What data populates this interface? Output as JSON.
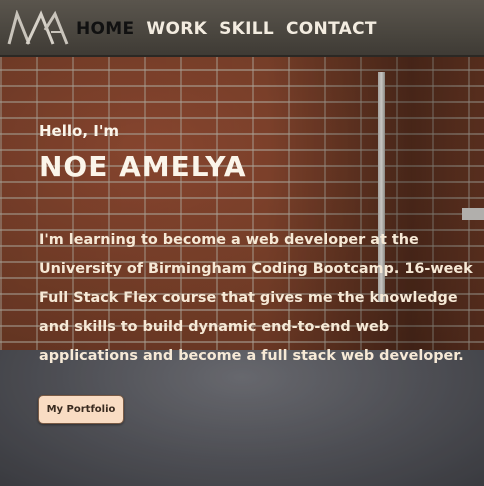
{
  "header": {
    "logo_text": "NA",
    "nav": [
      {
        "label": "HOME",
        "active": true
      },
      {
        "label": "WORK",
        "active": false
      },
      {
        "label": "SKILL",
        "active": false
      },
      {
        "label": "CONTACT",
        "active": false
      }
    ]
  },
  "hero": {
    "greeting": "Hello, I'm",
    "name": "NOE AMELYA",
    "bio": "I'm learning to become a web developer at the University of Birmingham Coding Bootcamp. 16-week Full Stack Flex course that gives me the knowledge and skills to build dynamic end-to-end web applications and become a full stack web developer.",
    "cta_label": "My Portfolio"
  },
  "colors": {
    "header_bg": "#4a463f",
    "nav_text": "#f3ece0",
    "nav_active": "#111111",
    "button_bg": "#f9dcc3"
  }
}
